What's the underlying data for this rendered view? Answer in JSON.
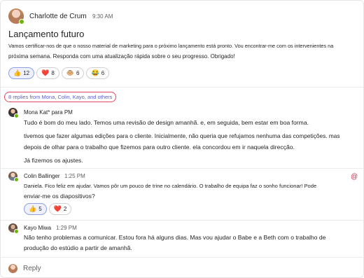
{
  "post": {
    "author": "Charlotte de Crum",
    "time": "9:30 AM",
    "title": "Lançamento futuro",
    "body_line1": "Vamos certificar-nos de que o nosso material de marketing para o próximo lançamento está pronto. Vou encontrar-me com os intervenientes na",
    "body_line2": "próxima semana. Responda com uma atualização rápida sobre o seu progresso. Obrigado!",
    "reactions": [
      {
        "emoji": "👍",
        "count": "12",
        "mine": true
      },
      {
        "emoji": "❤️",
        "count": "8",
        "mine": false
      },
      {
        "emoji": "🐵",
        "count": "6",
        "mine": false
      },
      {
        "emoji": "😂",
        "count": "6",
        "mine": false
      }
    ]
  },
  "thread": {
    "replies_summary": "8 replies from Mona, Colin, Kayo, and others"
  },
  "replies": [
    {
      "author": "Mona Kat* para PM",
      "time": "",
      "lines": [
        "Tudo é bom do meu lado. Temos uma revisão de design amanhã. e, em seguida, bem estar em boa forma.",
        "tivemos que fazer algumas edições para o cliente. Inicialmente, não queria que refujamos nenhuma das competições. mas",
        "depois de olhar para o trabalho que fizemos para outro cliente. ela concordou em ir naquela direcção.",
        "Já fizemos os ajustes."
      ]
    },
    {
      "author": "Colin Ballinger",
      "time": "1:25 PM",
      "lines": [
        "Daniela. Fico feliz em ajudar. Vamos pôr um pouco de trine no calendário. O trabalho de equipa faz o sonho funcionar! Pode",
        "enviar-me os diapositivos?"
      ],
      "mention_icon": "@",
      "reactions": [
        {
          "emoji": "👍",
          "count": "5",
          "mine": true
        },
        {
          "emoji": "❤️",
          "count": "2",
          "mine": false
        }
      ]
    },
    {
      "author": "Kayo Miwa",
      "time": "1:29 PM",
      "lines": [
        "Não tenho problemas a comunicar. Estou fora há alguns dias. Mas vou ajudar o Babe e a Beth com o trabalho de",
        "produção do estúdio a partir de amanhã."
      ]
    }
  ],
  "composer": {
    "reply_label": "Reply"
  }
}
